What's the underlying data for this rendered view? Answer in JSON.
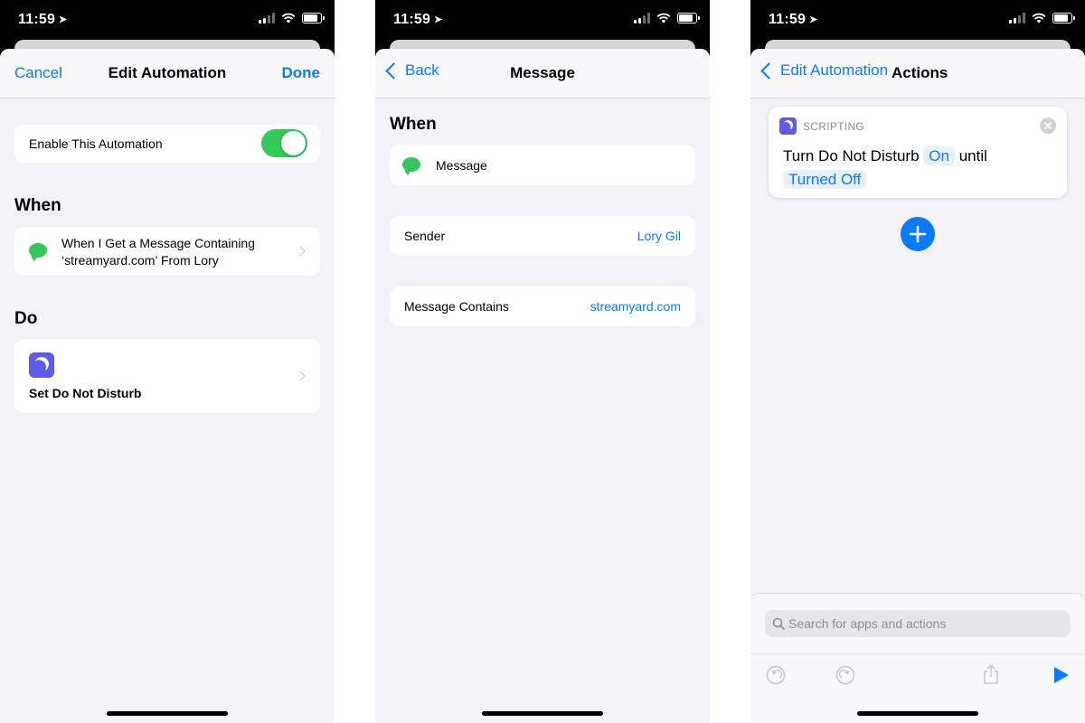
{
  "status_bar": {
    "time": "11:59"
  },
  "screen1": {
    "nav": {
      "cancel": "Cancel",
      "title": "Edit Automation",
      "done": "Done"
    },
    "enable_label": "Enable This Automation",
    "toggle_on": true,
    "when_title": "When",
    "trigger_line1": "When I Get a Message Containing",
    "trigger_line2": "‘streamyard.com’ From Lory",
    "do_title": "Do",
    "action_label": "Set Do Not Disturb"
  },
  "screen2": {
    "nav": {
      "back": "Back",
      "title": "Message"
    },
    "when_title": "When",
    "trigger_label": "Message",
    "sender_label": "Sender",
    "sender_value": "Lory Gil",
    "contains_label": "Message Contains",
    "contains_value": "streamyard.com"
  },
  "screen3": {
    "nav": {
      "back": "Edit Automation",
      "title": "Actions"
    },
    "action_category": "SCRIPTING",
    "action_text_1": "Turn Do Not Disturb",
    "action_param_state": "On",
    "action_text_2": "until",
    "action_param_until": "Turned Off",
    "search_placeholder": "Search for apps and actions"
  },
  "icons": [
    "location-arrow-icon",
    "signal-icon",
    "wifi-icon",
    "battery-icon",
    "message-icon",
    "moon-icon",
    "chevron-right-icon",
    "chevron-left-icon",
    "close-icon",
    "plus-icon",
    "search-icon",
    "undo-icon",
    "redo-icon",
    "share-icon",
    "play-icon"
  ],
  "colors": {
    "accent": "#0a7aff",
    "toggle_on": "#34c759",
    "dnd": "#5e5ce6",
    "background": "#f2f2f7"
  }
}
